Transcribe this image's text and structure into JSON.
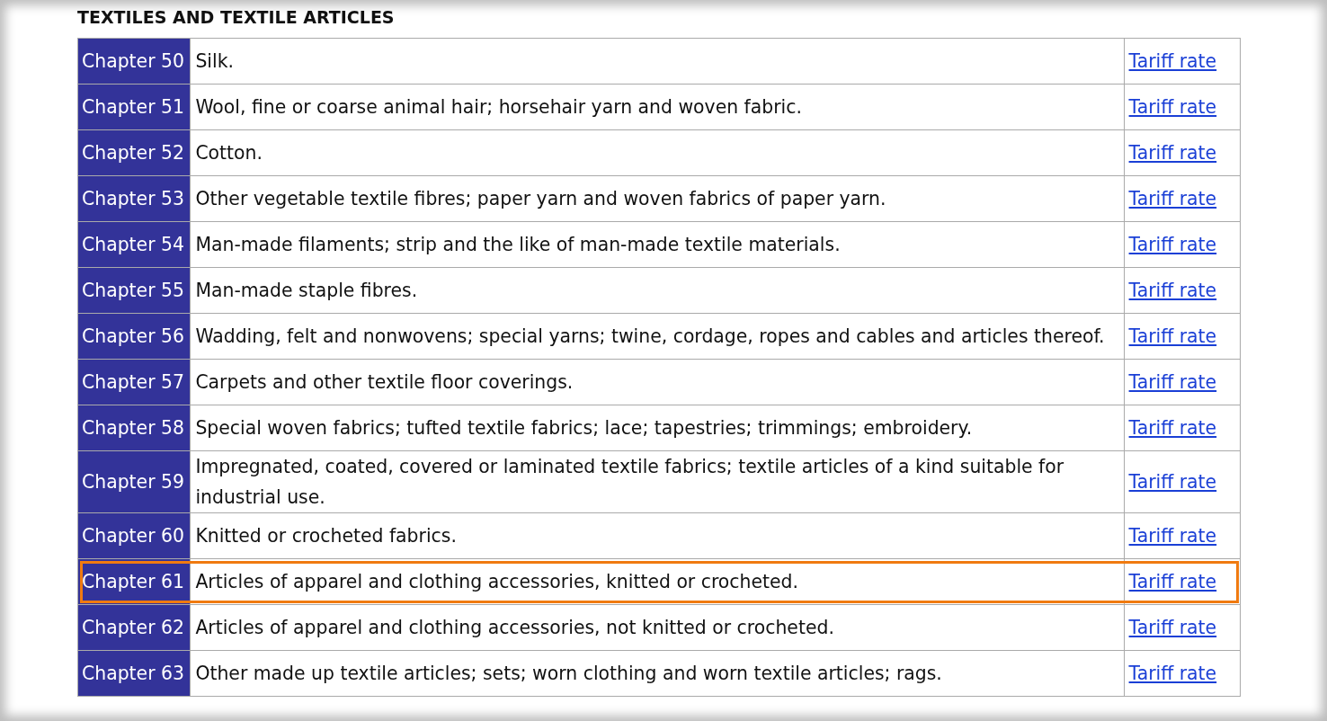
{
  "heading": "TEXTILES AND TEXTILE ARTICLES",
  "rows": [
    {
      "chapter": "Chapter 50",
      "description": "Silk.",
      "link": "Tariff rate",
      "highlighted": false
    },
    {
      "chapter": "Chapter 51",
      "description": "Wool, fine or coarse animal hair; horsehair yarn and woven fabric.",
      "link": "Tariff rate",
      "highlighted": false
    },
    {
      "chapter": "Chapter 52",
      "description": "Cotton.",
      "link": "Tariff rate",
      "highlighted": false
    },
    {
      "chapter": "Chapter 53",
      "description": "Other vegetable textile fibres; paper yarn and woven fabrics of paper yarn.",
      "link": "Tariff rate",
      "highlighted": false
    },
    {
      "chapter": "Chapter 54",
      "description": "Man-made filaments; strip and the like of man-made textile materials.",
      "link": "Tariff rate",
      "highlighted": false
    },
    {
      "chapter": "Chapter 55",
      "description": "Man-made staple fibres.",
      "link": "Tariff rate",
      "highlighted": false
    },
    {
      "chapter": "Chapter 56",
      "description": "Wadding, felt and nonwovens; special yarns; twine, cordage, ropes and cables and articles thereof.",
      "link": "Tariff rate",
      "highlighted": false
    },
    {
      "chapter": "Chapter 57",
      "description": "Carpets and other textile floor coverings.",
      "link": "Tariff rate",
      "highlighted": false
    },
    {
      "chapter": "Chapter 58",
      "description": "Special woven fabrics; tufted textile fabrics; lace; tapestries; trimmings; embroidery.",
      "link": "Tariff rate",
      "highlighted": false
    },
    {
      "chapter": "Chapter 59",
      "description": "Impregnated, coated, covered or laminated textile fabrics; textile articles of a kind suitable for industrial use.",
      "link": "Tariff rate",
      "highlighted": false
    },
    {
      "chapter": "Chapter 60",
      "description": "Knitted or crocheted fabrics.",
      "link": "Tariff rate",
      "highlighted": false
    },
    {
      "chapter": "Chapter 61",
      "description": "Articles of apparel and clothing accessories, knitted or crocheted.",
      "link": "Tariff rate",
      "highlighted": true
    },
    {
      "chapter": "Chapter 62",
      "description": "Articles of apparel and clothing accessories, not knitted or crocheted.",
      "link": "Tariff rate",
      "highlighted": false
    },
    {
      "chapter": "Chapter 63",
      "description": "Other made up textile articles; sets; worn clothing and worn textile articles; rags.",
      "link": "Tariff rate",
      "highlighted": false
    }
  ]
}
